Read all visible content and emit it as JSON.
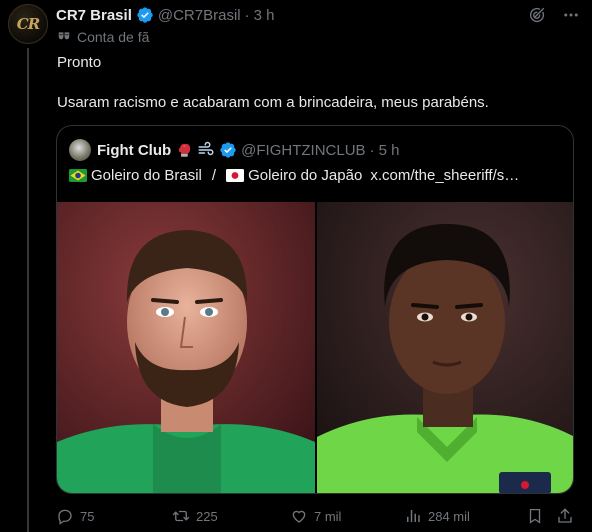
{
  "post": {
    "author_name": "CR7 Brasil",
    "handle": "@CR7Brasil",
    "separator": "·",
    "time": "3 h",
    "avatar_monogram": "CR",
    "fan_label": "Conta de fã",
    "text_line1": "Pronto",
    "text_line2": "Usaram racismo e acabaram com a brincadeira, meus parabéns."
  },
  "quote": {
    "author_name": "Fight Club",
    "emojis": [
      "boxing-glove",
      "dash"
    ],
    "handle": "@FIGHTZINCLUB",
    "separator": "·",
    "time": "5 h",
    "text_part1": "Goleiro do Brasil",
    "divider": "/",
    "text_part2": "Goleiro do Japão",
    "link": "x.com/the_sheeriff/s…",
    "images": [
      {
        "semantic": "goalkeeper-brazil-photo",
        "accent": "#22a35a"
      },
      {
        "semantic": "goalkeeper-japan-photo",
        "accent": "#6fd648"
      }
    ]
  },
  "actions": {
    "replies": "75",
    "reposts": "225",
    "likes": "7 mil",
    "views": "284 mil"
  },
  "icons": [
    "verified-badge-icon",
    "grok-icon",
    "more-icon",
    "fan-mask-icon",
    "reply-icon",
    "repost-icon",
    "like-icon",
    "views-icon",
    "bookmark-icon",
    "share-icon"
  ],
  "colors": {
    "background": "#000000",
    "text": "#e7e9ea",
    "muted": "#71767b",
    "verified": "#1d9bf0",
    "border": "#2f3336"
  }
}
